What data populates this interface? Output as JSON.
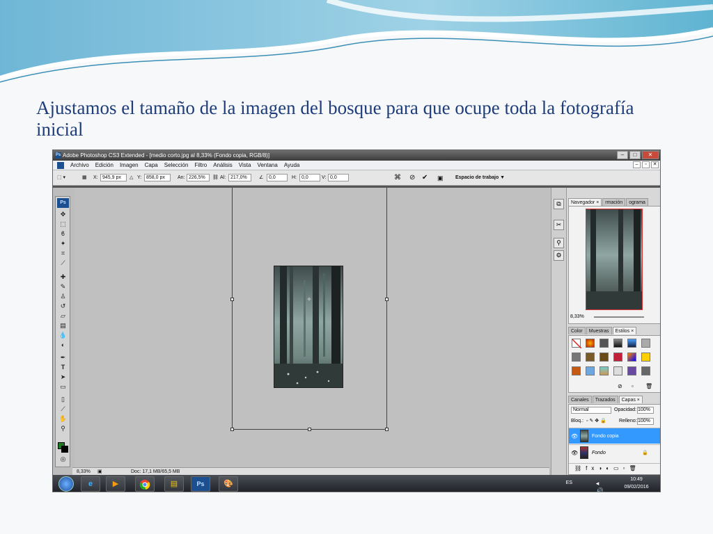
{
  "slide": {
    "title": "Ajustamos el tamaño de la imagen del bosque para que ocupe toda la fotografía inicial"
  },
  "app": {
    "window_title": "Adobe Photoshop CS3 Extended - [medio corto.jpg al 8,33% (Fondo copia, RGB/8)]",
    "logo": "Ps",
    "menu": [
      "Archivo",
      "Edición",
      "Imagen",
      "Capa",
      "Selección",
      "Filtro",
      "Análisis",
      "Vista",
      "Ventana",
      "Ayuda"
    ]
  },
  "options": {
    "x_label": "X:",
    "x_value": "945,9 px",
    "y_label": "Y:",
    "y_value": "858,0 px",
    "w_label": "An:",
    "w_value": "226,5%",
    "h_label": "Al:",
    "h_value": "217,0%",
    "angle_value": "0,0",
    "hskew_label": "H:",
    "hskew_value": "0,0",
    "vskew_label": "V:",
    "vskew_value": "0,0",
    "workspace": "Espacio de trabajo ▼"
  },
  "status": {
    "zoom": "8,33%",
    "doc": "Doc: 17,1 MB/65,5 MB"
  },
  "panels": {
    "navigator_tabs": [
      "Navegador ×",
      "rmación",
      "ograma"
    ],
    "navigator_zoom": "8,33%",
    "style_tabs": [
      "Color",
      "Muestras",
      "Estilos ×"
    ],
    "layer_tabs": [
      "Canales",
      "Trazados",
      "Capas ×"
    ],
    "blend_mode": "Normal",
    "opacity_label": "Opacidad:",
    "opacity_value": "100%",
    "lock_label": "Bloq.:",
    "fill_label": "Relleno:",
    "fill_value": "100%",
    "layers": [
      {
        "name": "Fondo copia",
        "selected": true
      },
      {
        "name": "Fondo",
        "selected": false
      }
    ]
  },
  "taskbar": {
    "language": "ES",
    "time": "10:49",
    "date": "09/02/2016"
  },
  "colors": {
    "title": "#1f3d7a",
    "selection": "#3399ff",
    "foreground_swatch": "#1e7a23"
  }
}
